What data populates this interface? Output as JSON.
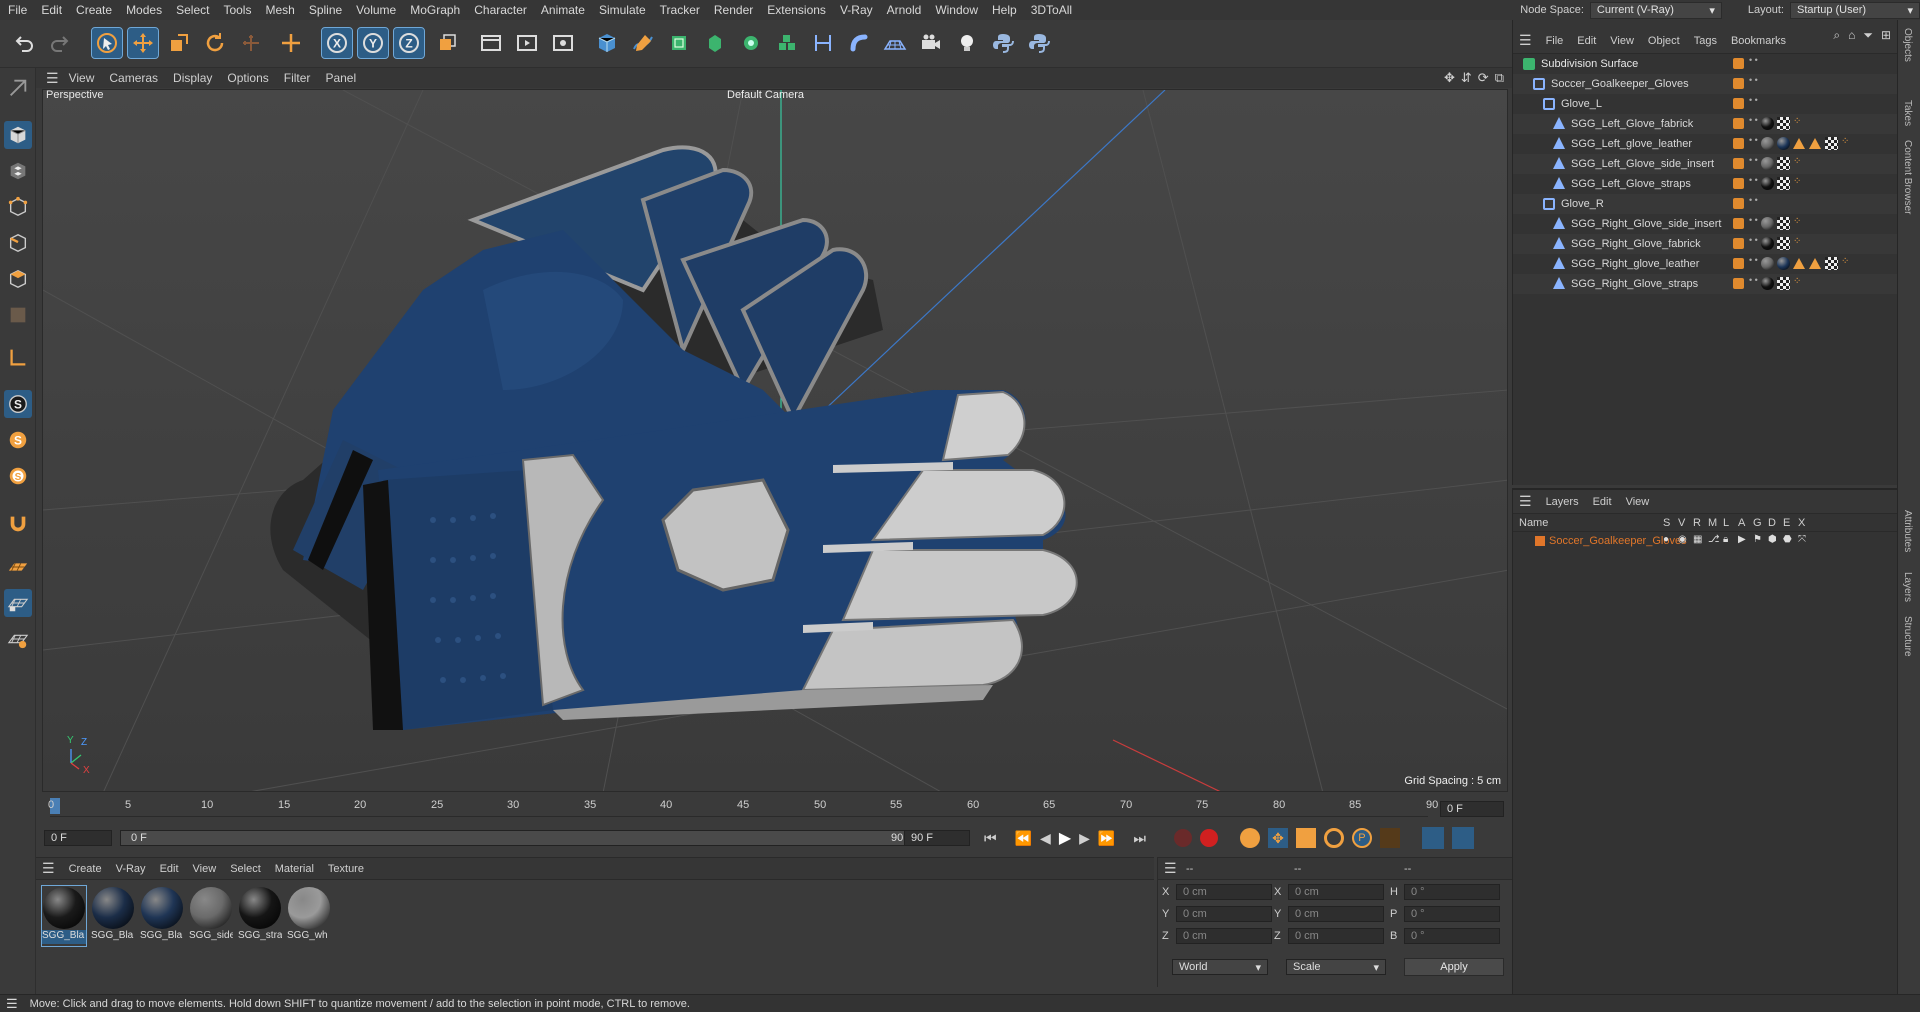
{
  "menubar": {
    "items": [
      "File",
      "Edit",
      "Create",
      "Modes",
      "Select",
      "Tools",
      "Mesh",
      "Spline",
      "Volume",
      "MoGraph",
      "Character",
      "Animate",
      "Simulate",
      "Tracker",
      "Render",
      "Extensions",
      "V-Ray",
      "Arnold",
      "Window",
      "Help",
      "3DToAll"
    ],
    "node_space_label": "Node Space:",
    "node_space_value": "Current (V-Ray)",
    "layout_label": "Layout:",
    "layout_value": "Startup (User)"
  },
  "viewport": {
    "menu": [
      "View",
      "Cameras",
      "Display",
      "Options",
      "Filter",
      "Panel"
    ],
    "name": "Perspective",
    "camera": "Default Camera",
    "grid_spacing": "Grid Spacing : 5 cm",
    "axis_x": "X",
    "axis_y": "Y",
    "axis_z": "Z"
  },
  "timeline": {
    "ticks": [
      "0",
      "5",
      "10",
      "15",
      "20",
      "25",
      "30",
      "35",
      "40",
      "45",
      "50",
      "55",
      "60",
      "65",
      "70",
      "75",
      "80",
      "85",
      "90"
    ],
    "current_frame": "0 F",
    "start_field": "0 F",
    "range_start": "0 F",
    "range_end": "90 F",
    "end_field": "90 F"
  },
  "materials": {
    "menu": [
      "Create",
      "V-Ray",
      "Edit",
      "View",
      "Select",
      "Material",
      "Texture"
    ],
    "items": [
      {
        "name": "SGG_Bla",
        "color": "#1a1a1a"
      },
      {
        "name": "SGG_Bla",
        "color": "#1b2d48"
      },
      {
        "name": "SGG_Bla",
        "color": "#1f3555"
      },
      {
        "name": "SGG_side",
        "color": "#6a6a6a"
      },
      {
        "name": "SGG_stra",
        "color": "#151515"
      },
      {
        "name": "SGG_wh",
        "color": "#9a9a9a"
      }
    ]
  },
  "coords": {
    "header": [
      "--",
      "--",
      "--"
    ],
    "rows": [
      {
        "a": "X",
        "av": "0 cm",
        "b": "X",
        "bv": "0 cm",
        "c": "H",
        "cv": "0 °"
      },
      {
        "a": "Y",
        "av": "0 cm",
        "b": "Y",
        "bv": "0 cm",
        "c": "P",
        "cv": "0 °"
      },
      {
        "a": "Z",
        "av": "0 cm",
        "b": "Z",
        "bv": "0 cm",
        "c": "B",
        "cv": "0 °"
      }
    ],
    "world": "World",
    "scale": "Scale",
    "apply": "Apply"
  },
  "objects": {
    "menu": [
      "File",
      "Edit",
      "View",
      "Object",
      "Tags",
      "Bookmarks"
    ],
    "tree": [
      {
        "name": "Subdivision Surface",
        "indent": 0,
        "type": "subdiv"
      },
      {
        "name": "Soccer_Goalkeeper_Gloves",
        "indent": 1,
        "type": "null"
      },
      {
        "name": "Glove_L",
        "indent": 2,
        "type": "null"
      },
      {
        "name": "SGG_Left_Glove_fabrick",
        "indent": 3,
        "type": "poly",
        "tags": [
          "black",
          "checker",
          "dots"
        ]
      },
      {
        "name": "SGG_Left_glove_leather",
        "indent": 3,
        "type": "poly",
        "tags": [
          "grey",
          "navy",
          "tri",
          "tri",
          "checker",
          "dots"
        ]
      },
      {
        "name": "SGG_Left_Glove_side_insert",
        "indent": 3,
        "type": "poly",
        "tags": [
          "grey",
          "checker",
          "dots"
        ]
      },
      {
        "name": "SGG_Left_Glove_straps",
        "indent": 3,
        "type": "poly",
        "tags": [
          "black",
          "checker",
          "dots"
        ]
      },
      {
        "name": "Glove_R",
        "indent": 2,
        "type": "null"
      },
      {
        "name": "SGG_Right_Glove_side_insert",
        "indent": 3,
        "type": "poly",
        "tags": [
          "grey",
          "checker",
          "dots"
        ]
      },
      {
        "name": "SGG_Right_Glove_fabrick",
        "indent": 3,
        "type": "poly",
        "tags": [
          "black",
          "checker",
          "dots"
        ]
      },
      {
        "name": "SGG_Right_glove_leather",
        "indent": 3,
        "type": "poly",
        "tags": [
          "grey",
          "navy",
          "tri",
          "tri",
          "checker",
          "dots"
        ]
      },
      {
        "name": "SGG_Right_Glove_straps",
        "indent": 3,
        "type": "poly",
        "tags": [
          "black",
          "checker",
          "dots"
        ]
      }
    ]
  },
  "layers": {
    "menu": [
      "Layers",
      "Edit",
      "View"
    ],
    "col_name": "Name",
    "cols": [
      "S",
      "V",
      "R",
      "M",
      "L",
      "A",
      "G",
      "D",
      "E",
      "X"
    ],
    "items": [
      {
        "name": "Soccer_Goalkeeper_Gloves",
        "color": "#e0762a"
      }
    ]
  },
  "sidetabs": [
    "Objects",
    "Takes",
    "Content Browser",
    "Attributes",
    "Layers",
    "Structure"
  ],
  "status": "Move: Click and drag to move elements. Hold down SHIFT to quantize movement / add to the selection in point mode, CTRL to remove.",
  "colors": {
    "accent": "#2d5d86",
    "orange": "#e08a2e",
    "glove_blue": "#1e3f66",
    "glove_white": "#cfcfcf"
  }
}
